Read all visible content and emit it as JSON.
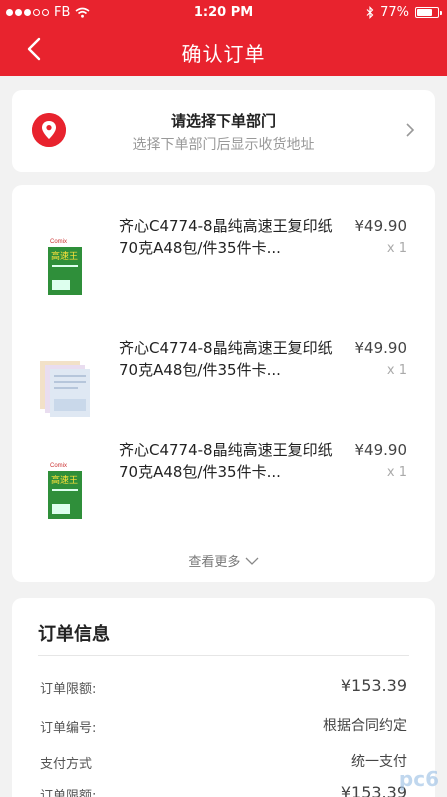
{
  "status_bar": {
    "carrier": "FB",
    "time": "1:20 PM",
    "battery": "77%",
    "battery_level": 0.77
  },
  "nav": {
    "title": "确认订单"
  },
  "address": {
    "title": "请选择下单部门",
    "subtitle": "选择下单部门后显示收货地址"
  },
  "goods": {
    "items": [
      {
        "name": "齐心C4774-8晶纯高速王复印纸70克A48包/件35件卡...",
        "price": "¥49.90",
        "qty": "x 1",
        "thumb": "paper-box-green"
      },
      {
        "name": "齐心C4774-8晶纯高速王复印纸70克A48包/件35件卡...",
        "price": "¥49.90",
        "qty": "x 1",
        "thumb": "paper-forms"
      },
      {
        "name": "齐心C4774-8晶纯高速王复印纸70克A48包/件35件卡...",
        "price": "¥49.90",
        "qty": "x 1",
        "thumb": "paper-box-green"
      }
    ],
    "more": "查看更多"
  },
  "order_info": {
    "heading": "订单信息",
    "rows": [
      {
        "label": "订单限额:",
        "value": "¥153.39"
      },
      {
        "label": "订单编号:",
        "value": "根据合同约定"
      },
      {
        "label": "支付方式",
        "value": "统一支付"
      },
      {
        "label": "订单限额:",
        "value": "¥153.39"
      }
    ]
  },
  "watermark": "pc6",
  "colors": {
    "accent": "#e8232e"
  }
}
